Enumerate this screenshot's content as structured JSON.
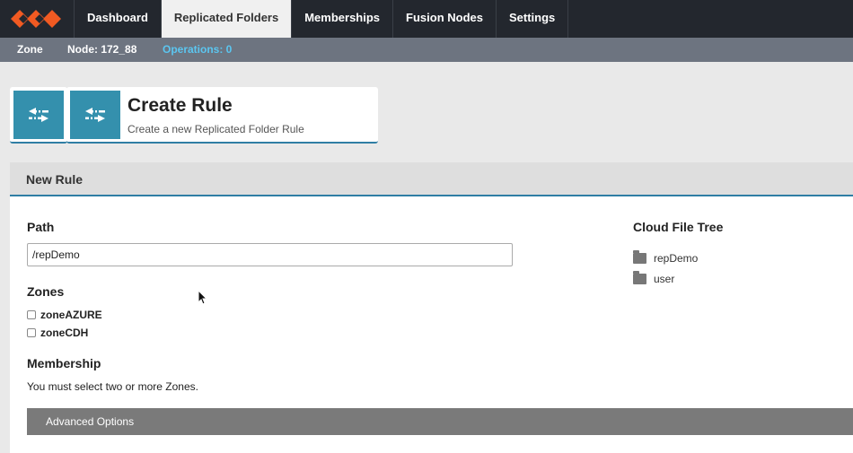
{
  "nav": {
    "tabs": [
      {
        "label": "Dashboard"
      },
      {
        "label": "Replicated Folders"
      },
      {
        "label": "Memberships"
      },
      {
        "label": "Fusion Nodes"
      },
      {
        "label": "Settings"
      }
    ],
    "active_tab": "Replicated Folders",
    "logo_color": "#f15a22"
  },
  "subbar": {
    "zone_label": "Zone",
    "node_label": "Node: 172_88",
    "operations_label": "Operations: 0"
  },
  "header": {
    "title": "Create Rule",
    "subtitle": "Create a new Replicated Folder Rule",
    "accent": "#3490ad"
  },
  "panel": {
    "title": "New Rule",
    "path_label": "Path",
    "path_value": "/repDemo",
    "zones_label": "Zones",
    "zones": [
      {
        "label": "zoneAZURE",
        "checked": false
      },
      {
        "label": "zoneCDH",
        "checked": false
      }
    ],
    "membership_label": "Membership",
    "membership_note": "You must select two or more Zones.",
    "advanced_label": "Advanced Options",
    "tree_title": "Cloud File Tree",
    "tree_items": [
      {
        "label": "repDemo",
        "icon": "folder-icon"
      },
      {
        "label": "user",
        "icon": "folder-icon"
      }
    ]
  }
}
